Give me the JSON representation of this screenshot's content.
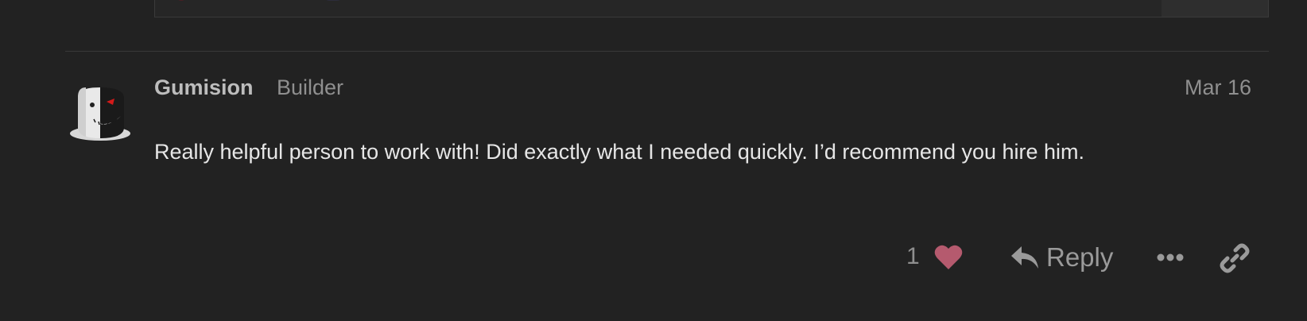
{
  "post": {
    "username": "Gumision",
    "user_title": "Builder",
    "date": "Mar 16",
    "body": "Really helpful person to work with! Did exactly what I needed quickly. I’d recommend you hire him."
  },
  "actions": {
    "like_count": "1",
    "reply_label": "Reply"
  },
  "icons": {
    "like": "heart-icon",
    "reply": "reply-arrow-icon",
    "more": "ellipsis-icon",
    "share": "link-icon"
  },
  "colors": {
    "background": "#222222",
    "heart": "#b55a6e",
    "muted": "#8f8f8f",
    "text": "#e6e6e6"
  }
}
